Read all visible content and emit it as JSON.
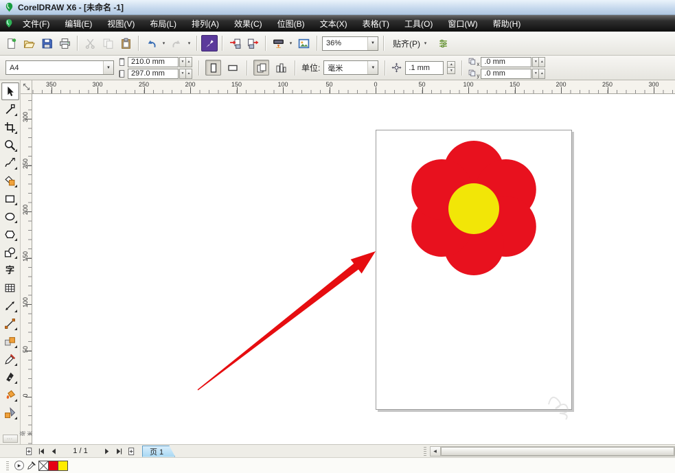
{
  "window": {
    "title": "CorelDRAW X6 - [未命名 -1]"
  },
  "menu": {
    "items": [
      "文件(F)",
      "编辑(E)",
      "视图(V)",
      "布局(L)",
      "排列(A)",
      "效果(C)",
      "位图(B)",
      "文本(X)",
      "表格(T)",
      "工具(O)",
      "窗口(W)",
      "帮助(H)"
    ],
    "ids": [
      "file",
      "edit",
      "view",
      "layout",
      "arrange",
      "effects",
      "bitmaps",
      "text",
      "table",
      "tools",
      "window",
      "help"
    ]
  },
  "standard_toolbar": {
    "groups": [
      [
        {
          "name": "new-document"
        },
        {
          "name": "open"
        },
        {
          "name": "save"
        },
        {
          "name": "print"
        }
      ],
      [
        {
          "name": "cut",
          "disabled": true
        },
        {
          "name": "copy",
          "disabled": true
        },
        {
          "name": "paste"
        }
      ],
      [
        {
          "name": "undo",
          "dropdown": true
        },
        {
          "name": "redo",
          "disabled": true,
          "dropdown": true
        }
      ],
      [
        {
          "name": "search-content",
          "accent": true
        }
      ],
      [
        {
          "name": "import"
        },
        {
          "name": "export"
        }
      ],
      [
        {
          "name": "application-launcher",
          "dropdown": true
        },
        {
          "name": "welcome-screen"
        }
      ]
    ],
    "zoom_value": "36%",
    "snap_label": "贴齐(P)"
  },
  "property_bar": {
    "paper_size": "A4",
    "paper_width": "210.0 mm",
    "paper_height": "297.0 mm",
    "units_label": "单位:",
    "units_value": "毫米",
    "nudge_value": ".1 mm",
    "duplicate_x_value": ".0 mm",
    "duplicate_y_value": ".0 mm",
    "duplicate_x_sub": "x",
    "duplicate_y_sub": "y"
  },
  "rulers": {
    "units": "毫米",
    "horizontal": [
      {
        "label": "350",
        "mm": -350
      },
      {
        "label": "300",
        "mm": -300
      },
      {
        "label": "250",
        "mm": -250
      },
      {
        "label": "200",
        "mm": -200
      },
      {
        "label": "150",
        "mm": -150
      },
      {
        "label": "100",
        "mm": -100
      },
      {
        "label": "50",
        "mm": -50
      },
      {
        "label": "0",
        "mm": 0
      },
      {
        "label": "50",
        "mm": 50
      },
      {
        "label": "100",
        "mm": 100
      },
      {
        "label": "150",
        "mm": 150
      },
      {
        "label": "200",
        "mm": 200
      },
      {
        "label": "250",
        "mm": 250
      },
      {
        "label": "300",
        "mm": 300
      }
    ],
    "vertical": [
      {
        "label": "300",
        "mm": 300
      },
      {
        "label": "250",
        "mm": 250
      },
      {
        "label": "200",
        "mm": 200
      },
      {
        "label": "150",
        "mm": 150
      },
      {
        "label": "100",
        "mm": 100
      },
      {
        "label": "50",
        "mm": 50
      },
      {
        "label": "0",
        "mm": 0
      }
    ]
  },
  "toolbox": [
    {
      "name": "pick-tool",
      "selected": true,
      "flyout": false
    },
    {
      "name": "shape-tool",
      "flyout": true
    },
    {
      "name": "crop-tool",
      "flyout": true
    },
    {
      "name": "zoom-tool",
      "flyout": true
    },
    {
      "name": "freehand-tool",
      "flyout": true
    },
    {
      "name": "smart-fill-tool",
      "flyout": true
    },
    {
      "name": "rectangle-tool",
      "flyout": true
    },
    {
      "name": "ellipse-tool",
      "flyout": true
    },
    {
      "name": "polygon-tool",
      "flyout": true
    },
    {
      "name": "basic-shapes-tool",
      "flyout": true
    },
    {
      "name": "text-tool",
      "label": "字",
      "flyout": false
    },
    {
      "name": "table-tool",
      "flyout": false
    },
    {
      "name": "dimension-tool",
      "flyout": true
    },
    {
      "name": "connector-tool",
      "flyout": true
    },
    {
      "name": "blend-tool",
      "flyout": true
    },
    {
      "name": "color-eyedropper-tool",
      "flyout": true
    },
    {
      "name": "outline-pen-tool",
      "flyout": true
    },
    {
      "name": "fill-tool",
      "flyout": true
    },
    {
      "name": "interactive-fill-tool",
      "flyout": true
    }
  ],
  "canvas": {
    "flower": {
      "petal_count": 6,
      "petal_color": "#e8111e",
      "center_color": "#f2e607"
    },
    "arrow_color": "#e60d10"
  },
  "page_controls": {
    "indicator": "1 / 1",
    "tab_label": "页 1"
  },
  "document_palette": {
    "swatches": [
      {
        "name": "no-color-swatch",
        "color": ""
      },
      {
        "name": "red-swatch",
        "color": "#e60014"
      },
      {
        "name": "yellow-swatch",
        "color": "#ffec00"
      }
    ]
  }
}
